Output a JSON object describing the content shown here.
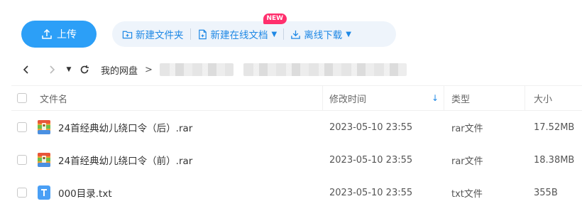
{
  "toolbar": {
    "upload_label": "上传",
    "new_folder_label": "新建文件夹",
    "new_online_doc_label": "新建在线文档",
    "new_badge": "NEW",
    "offline_download_label": "离线下载"
  },
  "nav": {
    "root_label": "我的网盘",
    "separator": ">"
  },
  "table": {
    "columns": {
      "name": "文件名",
      "modified": "修改时间",
      "type": "类型",
      "size": "大小"
    },
    "sort": {
      "column": "modified",
      "direction": "desc"
    },
    "rows": [
      {
        "name": "24首经典幼儿绕口令（后）.rar",
        "modified": "2023-05-10 23:55",
        "type": "rar文件",
        "size": "17.52MB",
        "icon": "rar-archive-icon"
      },
      {
        "name": "24首经典幼儿绕口令（前）.rar",
        "modified": "2023-05-10 23:55",
        "type": "rar文件",
        "size": "18.38MB",
        "icon": "rar-archive-icon"
      },
      {
        "name": "000目录.txt",
        "modified": "2023-05-10 23:55",
        "type": "txt文件",
        "size": "355B",
        "icon": "txt-file-icon"
      }
    ]
  },
  "colors": {
    "accent": "#2c9ff7",
    "toolbar_text": "#1e88e5",
    "badge": "#ff2f6d"
  }
}
